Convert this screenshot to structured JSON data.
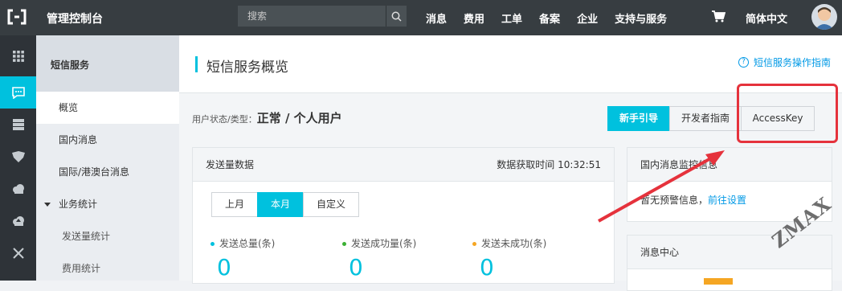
{
  "topbar": {
    "title": "管理控制台",
    "search_placeholder": "搜索",
    "nav": [
      "消息",
      "费用",
      "工单",
      "备案",
      "企业",
      "支持与服务"
    ],
    "cart_icon": "cart-icon",
    "language": "简体中文"
  },
  "iconbar": [
    "grid-icon",
    "message-icon",
    "database-icon",
    "security-icon",
    "cloud-icon",
    "cloud-upload-icon",
    "network-icon"
  ],
  "sidebar": {
    "title": "短信服务",
    "items": [
      "概览",
      "国内消息",
      "国际/港澳台消息"
    ],
    "group": "业务统计",
    "sub_items": [
      "发送量统计",
      "费用统计"
    ]
  },
  "main": {
    "title": "短信服务概览",
    "guide_link": "短信服务操作指南",
    "status_label": "用户状态/类型：",
    "status_value": "正常 / 个人用户",
    "buttons": [
      "新手引导",
      "开发者指南",
      "AccessKey"
    ],
    "send_panel": {
      "title": "发送量数据",
      "fetch_time": "数据获取时间 10:32:51",
      "tabs": [
        "上月",
        "本月",
        "自定义"
      ],
      "metrics": [
        {
          "label": "发送总量(条)",
          "value": "0",
          "color": "#00c1de"
        },
        {
          "label": "发送成功量(条)",
          "value": "0",
          "color": "#3cb034"
        },
        {
          "label": "发送未成功(条)",
          "value": "0",
          "color": "#f5a623"
        }
      ]
    },
    "monitor_panel": {
      "title": "国内消息监控信息",
      "text": "暂无预警信息，",
      "link": "前往设置"
    },
    "message_panel": {
      "title": "消息中心"
    }
  },
  "watermark": "ZMAX",
  "colors": {
    "accent": "#00c1de",
    "topbar": "#373d41",
    "annotation": "#e5323c",
    "link": "#0099e6"
  }
}
